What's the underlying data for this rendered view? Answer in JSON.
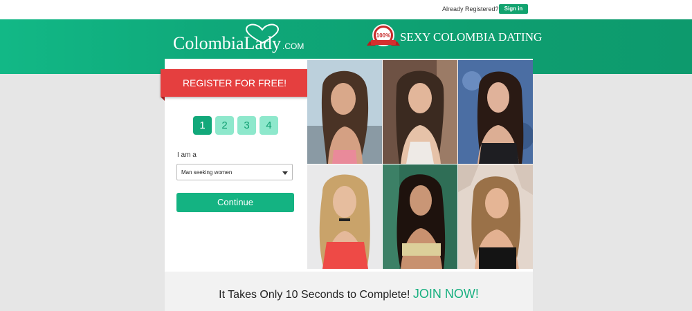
{
  "topbar": {
    "already_registered": "Already Registered?",
    "signin_label": "Sign in"
  },
  "header": {
    "logo_text": "ColombiaLady",
    "logo_suffix": ".COM",
    "badge_text": "100%",
    "tagline": "SEXY COLOMBIA DATING"
  },
  "register": {
    "banner": "REGISTER FOR FREE!",
    "steps": [
      "1",
      "2",
      "3",
      "4"
    ],
    "active_step": "1",
    "iam_label": "I am a",
    "select_value": "Man seeking women",
    "continue_label": "Continue"
  },
  "footer": {
    "text": "It Takes Only 10 Seconds to Complete!",
    "join": "JOIN NOW!"
  },
  "colors": {
    "brand_green": "#12a87a",
    "banner_red": "#e53f3f"
  }
}
